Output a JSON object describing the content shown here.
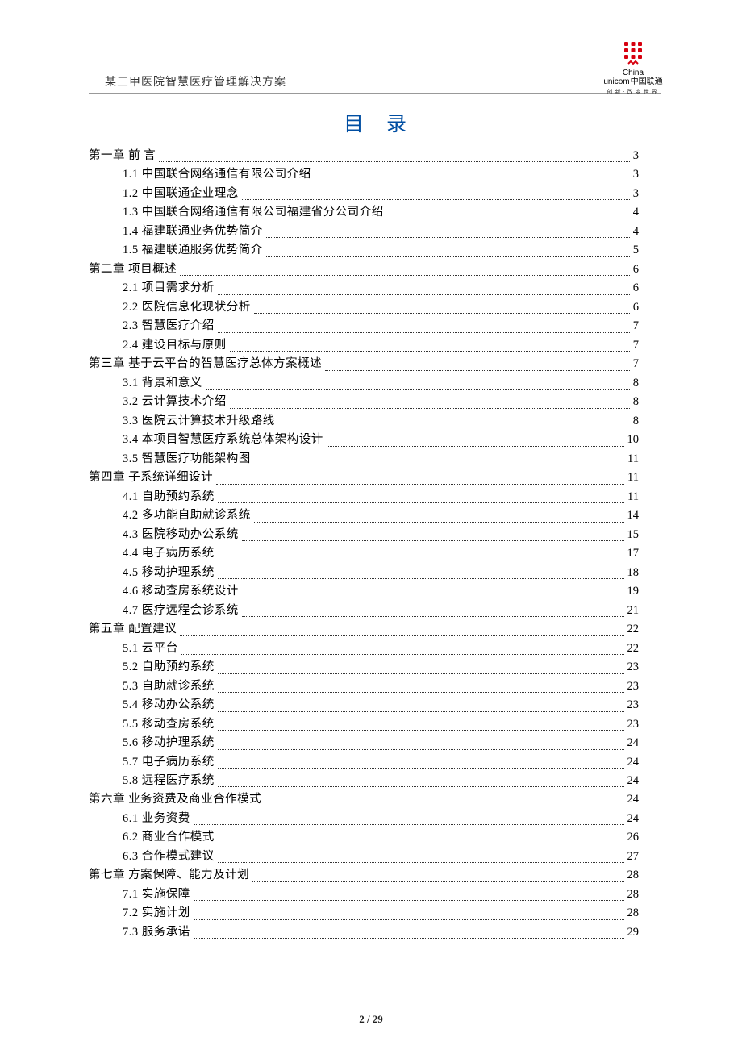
{
  "header": {
    "title": "某三甲医院智慧医疗管理解决方案"
  },
  "logo": {
    "line1": "China",
    "line2": "unicom",
    "cn": "中国联通",
    "tagline": "创新·改变世界"
  },
  "title": "目录",
  "footer": "2 / 29",
  "toc": [
    {
      "level": 1,
      "label": "第一章 前 言",
      "page": "3"
    },
    {
      "level": 2,
      "label": "1.1 中国联合网络通信有限公司介绍",
      "page": "3"
    },
    {
      "level": 2,
      "label": "1.2 中国联通企业理念",
      "page": "3"
    },
    {
      "level": 2,
      "label": "1.3 中国联合网络通信有限公司福建省分公司介绍",
      "page": "4"
    },
    {
      "level": 2,
      "label": "1.4 福建联通业务优势简介",
      "page": "4"
    },
    {
      "level": 2,
      "label": "1.5 福建联通服务优势简介",
      "page": "5"
    },
    {
      "level": 1,
      "label": "第二章 项目概述",
      "page": "6"
    },
    {
      "level": 2,
      "label": "2.1 项目需求分析",
      "page": "6"
    },
    {
      "level": 2,
      "label": "2.2 医院信息化现状分析",
      "page": "6"
    },
    {
      "level": 2,
      "label": "2.3 智慧医疗介绍",
      "page": "7"
    },
    {
      "level": 2,
      "label": "2.4 建设目标与原则",
      "page": "7"
    },
    {
      "level": 1,
      "label": "第三章 基于云平台的智慧医疗总体方案概述",
      "page": "7"
    },
    {
      "level": 2,
      "label": "3.1 背景和意义",
      "page": "8"
    },
    {
      "level": 2,
      "label": "3.2 云计算技术介绍",
      "page": "8"
    },
    {
      "level": 2,
      "label": "3.3 医院云计算技术升级路线",
      "page": "8"
    },
    {
      "level": 2,
      "label": "3.4 本项目智慧医疗系统总体架构设计",
      "page": "10"
    },
    {
      "level": 2,
      "label": "3.5 智慧医疗功能架构图",
      "page": "11"
    },
    {
      "level": 1,
      "label": "第四章 子系统详细设计",
      "page": "11"
    },
    {
      "level": 2,
      "label": "4.1 自助预约系统",
      "page": "11"
    },
    {
      "level": 2,
      "label": "4.2 多功能自助就诊系统",
      "page": "14"
    },
    {
      "level": 2,
      "label": "4.3 医院移动办公系统",
      "page": "15"
    },
    {
      "level": 2,
      "label": "4.4 电子病历系统",
      "page": "17"
    },
    {
      "level": 2,
      "label": "4.5 移动护理系统",
      "page": "18"
    },
    {
      "level": 2,
      "label": "4.6 移动查房系统设计",
      "page": "19"
    },
    {
      "level": 2,
      "label": "4.7 医疗远程会诊系统",
      "page": "21"
    },
    {
      "level": 1,
      "label": "第五章 配置建议",
      "page": "22"
    },
    {
      "level": 2,
      "label": "5.1 云平台",
      "page": "22"
    },
    {
      "level": 2,
      "label": "5.2 自助预约系统",
      "page": "23"
    },
    {
      "level": 2,
      "label": "5.3 自助就诊系统",
      "page": "23"
    },
    {
      "level": 2,
      "label": "5.4 移动办公系统",
      "page": "23"
    },
    {
      "level": 2,
      "label": "5.5 移动查房系统",
      "page": "23"
    },
    {
      "level": 2,
      "label": "5.6 移动护理系统",
      "page": "24"
    },
    {
      "level": 2,
      "label": "5.7 电子病历系统",
      "page": "24"
    },
    {
      "level": 2,
      "label": "5.8 远程医疗系统",
      "page": "24"
    },
    {
      "level": 1,
      "label": "第六章 业务资费及商业合作模式",
      "page": "24"
    },
    {
      "level": 2,
      "label": "6.1 业务资费",
      "page": "24"
    },
    {
      "level": 2,
      "label": "6.2 商业合作模式",
      "page": "26"
    },
    {
      "level": 2,
      "label": "6.3 合作模式建议",
      "page": "27"
    },
    {
      "level": 1,
      "label": "第七章 方案保障、能力及计划",
      "page": "28"
    },
    {
      "level": 2,
      "label": "7.1 实施保障",
      "page": "28"
    },
    {
      "level": 2,
      "label": "7.2 实施计划",
      "page": "28"
    },
    {
      "level": 2,
      "label": "7.3 服务承诺",
      "page": "29"
    }
  ]
}
